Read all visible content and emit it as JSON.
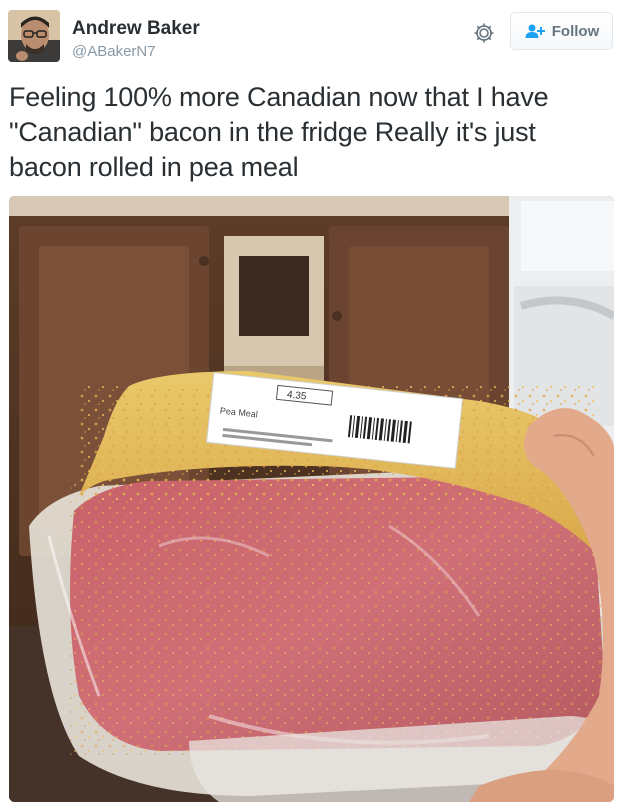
{
  "tweet": {
    "author_name": "Andrew Baker",
    "author_handle": "@ABakerN7",
    "follow_label": "Follow",
    "text": "Feeling 100% more Canadian now that I have \"Canadian\" bacon in the fridge Really it's just bacon rolled in pea meal"
  },
  "icons": {
    "gear": "gear-icon",
    "follow": "follow-user-icon",
    "avatar": "avatar-photo"
  },
  "colors": {
    "text": "#292f33",
    "secondary": "#8899a6",
    "accent": "#1da1f2",
    "button_border": "#e1e8ed"
  },
  "media": {
    "label_price": "4.35",
    "label_product": "Pea Meal"
  }
}
